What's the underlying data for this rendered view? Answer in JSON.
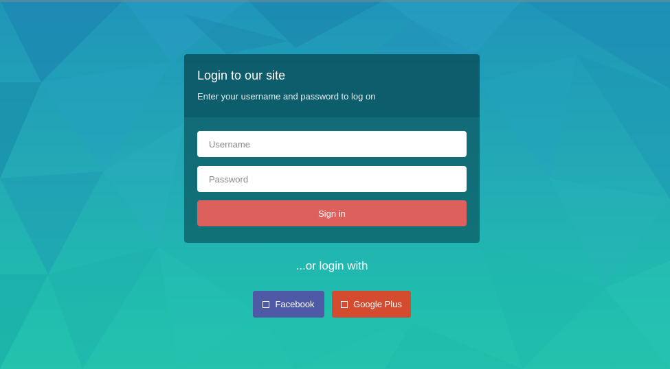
{
  "login": {
    "title": "Login to our site",
    "subtitle": "Enter your username and password to log on",
    "username_placeholder": "Username",
    "password_placeholder": "Password",
    "signin_label": "Sign in"
  },
  "social": {
    "or_text": "...or login with",
    "facebook_label": "Facebook",
    "google_label": "Google Plus",
    "facebook_icon": "square-icon",
    "google_icon": "square-icon"
  },
  "colors": {
    "signin": "#de605c",
    "facebook": "#4f5aa6",
    "google": "#d54b2f",
    "panel": "#064852"
  }
}
